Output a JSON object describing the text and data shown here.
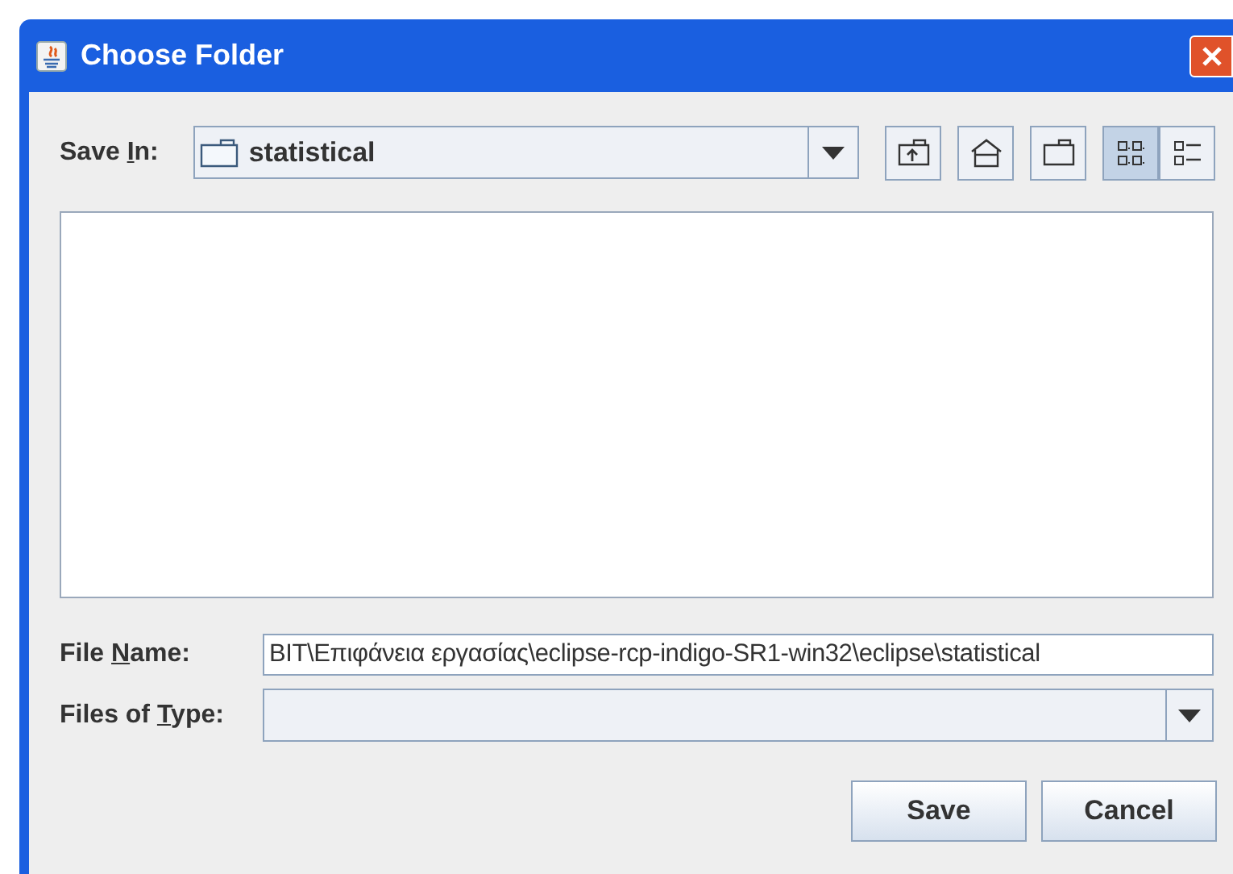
{
  "window": {
    "title": "Choose Folder"
  },
  "save_in": {
    "label": {
      "before": "Save ",
      "key": "I",
      "after": "n:"
    },
    "value": "statistical"
  },
  "toolbar": [
    {
      "kind": "up",
      "selected": false
    },
    {
      "kind": "home",
      "selected": false
    },
    {
      "kind": "new-folder",
      "selected": false
    },
    {
      "kind": "list",
      "selected": true
    },
    {
      "kind": "details",
      "selected": false
    }
  ],
  "file_name": {
    "label": {
      "before": "File ",
      "key": "N",
      "after": "ame:"
    },
    "value": "BIT\\Επιφάνεια εργασίας\\eclipse-rcp-indigo-SR1-win32\\eclipse\\statistical"
  },
  "files_of_type": {
    "label": {
      "before": "Files of ",
      "key": "T",
      "after": "ype:"
    }
  },
  "buttons": [
    "Save",
    "Cancel"
  ]
}
